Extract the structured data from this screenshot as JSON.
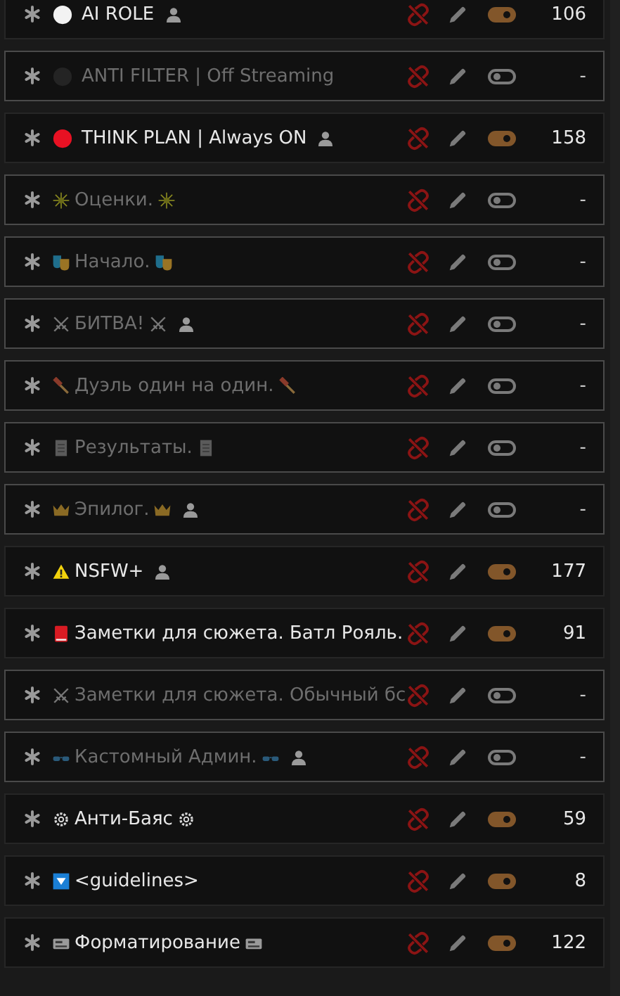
{
  "entries": [
    {
      "name": "AI ROLE",
      "user_badge": true,
      "enabled": true,
      "count": "106"
    },
    {
      "name": "ANTI FILTER | Off Streaming",
      "user_badge": false,
      "enabled": false,
      "count": "-"
    },
    {
      "name": "THINK PLAN | Always ON",
      "user_badge": true,
      "enabled": true,
      "count": "158"
    },
    {
      "name": "Оценки.",
      "user_badge": false,
      "enabled": false,
      "count": "-"
    },
    {
      "name": "Начало.",
      "user_badge": false,
      "enabled": false,
      "count": "-"
    },
    {
      "name": "БИТВА!",
      "user_badge": true,
      "enabled": false,
      "count": "-"
    },
    {
      "name": "Дуэль один на один.",
      "user_badge": false,
      "enabled": false,
      "count": "-"
    },
    {
      "name": "Результаты.",
      "user_badge": false,
      "enabled": false,
      "count": "-"
    },
    {
      "name": "Эпилог.",
      "user_badge": true,
      "enabled": false,
      "count": "-"
    },
    {
      "name": "NSFW+",
      "user_badge": true,
      "enabled": true,
      "count": "177"
    },
    {
      "name": "Заметки для сюжета. Батл Рояль.",
      "user_badge": false,
      "enabled": true,
      "count": "91"
    },
    {
      "name": "Заметки для сюжета. Обычный бс",
      "user_badge": false,
      "enabled": false,
      "count": "-"
    },
    {
      "name": "Кастомный Админ.",
      "user_badge": true,
      "enabled": false,
      "count": "-"
    },
    {
      "name": "Анти-Баяс",
      "user_badge": false,
      "enabled": true,
      "count": "59"
    },
    {
      "name": "<guidelines>",
      "user_badge": false,
      "enabled": true,
      "count": "8"
    },
    {
      "name": "Форматирование",
      "user_badge": false,
      "enabled": true,
      "count": "122"
    }
  ]
}
